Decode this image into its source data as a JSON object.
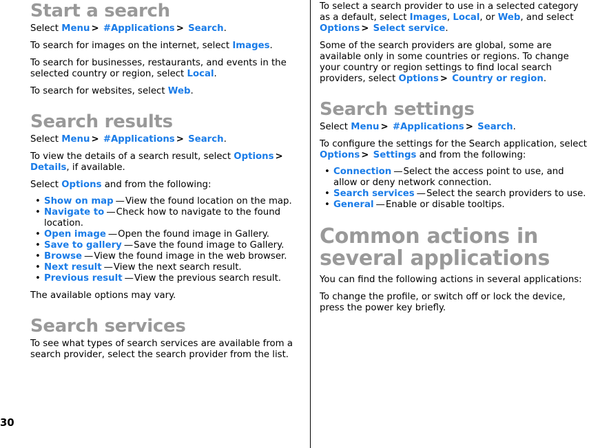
{
  "page": {
    "number": "30",
    "accent_color": "#1a7ce8",
    "heading_color": "#999999",
    "body_color": "#000000",
    "background_color": "#ffffff",
    "divider_color": "#000000"
  },
  "left_column": {
    "section_start_search": {
      "title": "Start a search",
      "path_intro": "Select",
      "path_1": "Menu",
      "path_sep_1": ">",
      "path_2": "#Applications",
      "path_sep_2": ">",
      "path_3": "Search",
      "path_end": ".",
      "p_images_pre": "To search for images on the internet, select ",
      "p_images_term": "Images",
      "p_images_post": ".",
      "p_local_pre": "To search for businesses, restaurants, and events in the selected country or region, select ",
      "p_local_term": "Local",
      "p_local_post": ".",
      "p_web_pre": "To search for websites, select ",
      "p_web_term": "Web",
      "p_web_post": "."
    },
    "section_search_results": {
      "title": "Search results",
      "path_intro": "Select",
      "path_1": "Menu",
      "path_sep_1": ">",
      "path_2": "#Applications",
      "path_sep_2": ">",
      "path_3": "Search",
      "path_end": ".",
      "p_details_pre": "To view the details of a search result, select ",
      "p_details_term_1": "Options",
      "p_details_sep": ">",
      "p_details_term_2": "Details",
      "p_details_post": ", if available.",
      "p_options_pre": "Select ",
      "p_options_term": "Options",
      "p_options_post": " and from the following:",
      "options": [
        {
          "bullet": "•",
          "term": "Show on map",
          "dash": "—",
          "desc": "View the found location on the map."
        },
        {
          "bullet": "•",
          "term": "Navigate to",
          "dash": "—",
          "desc": "Check how to navigate to the found location."
        },
        {
          "bullet": "•",
          "term": "Open image",
          "dash": "—",
          "desc": "Open the found image in Gallery."
        },
        {
          "bullet": "•",
          "term": "Save to gallery",
          "dash": "—",
          "desc": "Save the found image to Gallery."
        },
        {
          "bullet": "•",
          "term": "Browse",
          "dash": "—",
          "desc": "View the found image in the web browser."
        },
        {
          "bullet": "•",
          "term": "Next result",
          "dash": "—",
          "desc": "View the next search result."
        },
        {
          "bullet": "•",
          "term": "Previous result",
          "dash": "—",
          "desc": "View the previous search result."
        }
      ],
      "p_vary": "The available options may vary."
    },
    "section_search_services": {
      "title": "Search services",
      "p_types": "To see what types of search services are available from a search provider, select the search provider from the list."
    }
  },
  "right_column": {
    "continued_search_services": {
      "p_default_pre": "To select a search provider to use in a selected category as a default, select ",
      "p_default_term_1": "Images",
      "p_default_mid_1": ", ",
      "p_default_term_2": "Local",
      "p_default_mid_2": ", or ",
      "p_default_term_3": "Web",
      "p_default_mid_3": ", and select ",
      "p_default_term_4": "Options",
      "p_default_sep": ">",
      "p_default_term_5": "Select service",
      "p_default_post": ".",
      "p_global_pre": "Some of the search providers are global, some are available only in some countries or regions. To change your country or region settings to find local search providers, select ",
      "p_global_term_1": "Options",
      "p_global_sep": ">",
      "p_global_term_2": "Country or region",
      "p_global_post": "."
    },
    "section_search_settings": {
      "title": "Search settings",
      "path_intro": "Select",
      "path_1": "Menu",
      "path_sep_1": ">",
      "path_2": "#Applications",
      "path_sep_2": ">",
      "path_3": "Search",
      "path_end": ".",
      "p_configure_pre": "To configure the settings for the Search application, select ",
      "p_configure_term_1": "Options",
      "p_configure_sep": ">",
      "p_configure_term_2": "Settings",
      "p_configure_post": " and from the following:",
      "options": [
        {
          "bullet": "•",
          "term": "Connection",
          "dash": "—",
          "desc": "Select the access point to use, and allow or deny network connection."
        },
        {
          "bullet": "•",
          "term": "Search services",
          "dash": "—",
          "desc": "Select the search providers to use."
        },
        {
          "bullet": "•",
          "term": "General",
          "dash": "—",
          "desc": "Enable or disable tooltips."
        }
      ]
    },
    "chapter_common_actions": {
      "title": "Common actions in several applications",
      "p_find": "You can find the following actions in several applications:",
      "p_profile": "To change the profile, or switch off or lock the device, press the power key briefly."
    }
  }
}
